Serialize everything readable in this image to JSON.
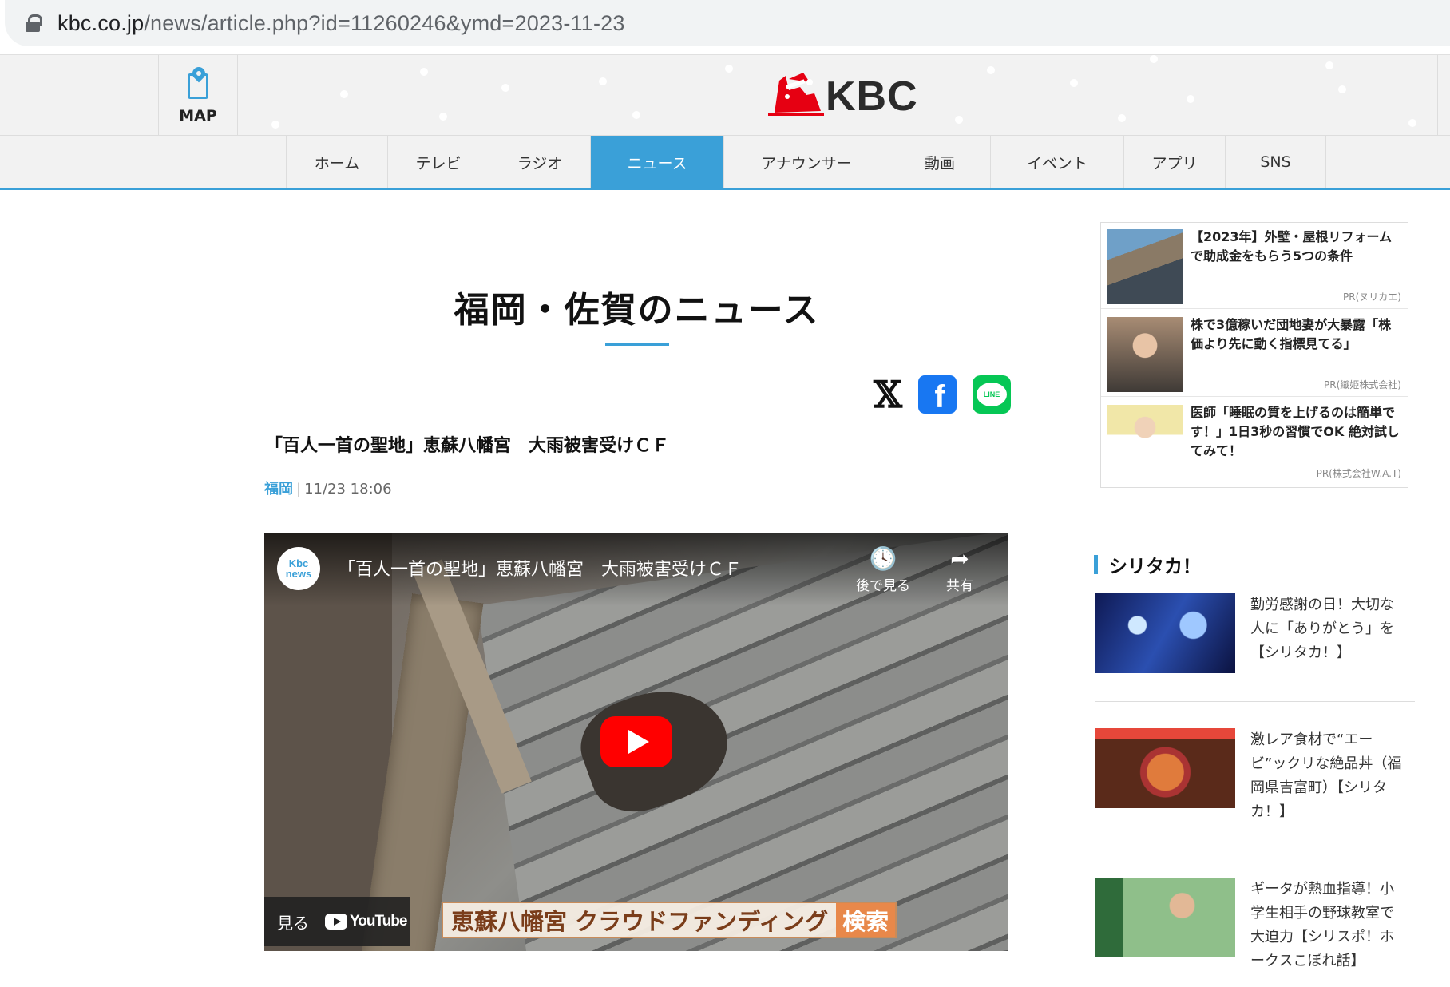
{
  "browser": {
    "url_domain": "kbc.co.jp",
    "url_path": "/news/article.php?id=11260246&ymd=2023-11-23"
  },
  "header": {
    "map_label": "MAP",
    "logo_text": "KBC"
  },
  "nav": {
    "items": [
      {
        "label": "ホーム",
        "width": 127
      },
      {
        "label": "テレビ",
        "width": 127
      },
      {
        "label": "ラジオ",
        "width": 127
      },
      {
        "label": "ニュース",
        "width": 167
      },
      {
        "label": "アナウンサー",
        "width": 207
      },
      {
        "label": "動画",
        "width": 127
      },
      {
        "label": "イベント",
        "width": 167
      },
      {
        "label": "アプリ",
        "width": 127
      },
      {
        "label": "SNS",
        "width": 127
      }
    ],
    "active_index": 3
  },
  "main": {
    "page_title": "福岡・佐賀のニュース",
    "share": {
      "x": "𝕏",
      "facebook": "f",
      "line": "LINE"
    },
    "headline": "「百人一首の聖地」恵蘇八幡宮　大雨被害受けＣＦ",
    "category": "福岡",
    "timestamp": "11/23 18:06"
  },
  "video": {
    "channel_top": "Kbc",
    "channel_bottom": "news",
    "title": "「百人一首の聖地」恵蘇八幡宮　大雨被害受けＣＦ",
    "watch_later_label": "後で見る",
    "share_label": "共有",
    "watch_on_label": "見る",
    "youtube_label": "YouTube",
    "caption_text": "恵蘇八幡宮 クラウドファンディング",
    "caption_button": "検索"
  },
  "ads": [
    {
      "title": "【2023年】外壁・屋根リフォームで助成金をもらう5つの条件",
      "source": "PR(ヌリカエ)"
    },
    {
      "title": "株で3億稼いだ団地妻が大暴露「株価より先に動く指標見てる」",
      "source": "PR(織姫株式会社)"
    },
    {
      "title": "医師「睡眠の質を上げるのは簡単です！」1日3秒の習慣でOK 絶対試してみて！",
      "source": "PR(株式会社W.A.T)"
    }
  ],
  "sidebar": {
    "section_title": "シリタカ！",
    "stories": [
      {
        "title": "勤労感謝の日！大切な人に「ありがとう」を【シリタカ！】"
      },
      {
        "title": "激レア食材で“エービ”ックリな絶品丼（福岡県吉富町）【シリタカ！】"
      },
      {
        "title": "ギータが熱血指導！小学生相手の野球教室で大迫力【シリスポ！ホークスこぼれ話】"
      }
    ]
  }
}
